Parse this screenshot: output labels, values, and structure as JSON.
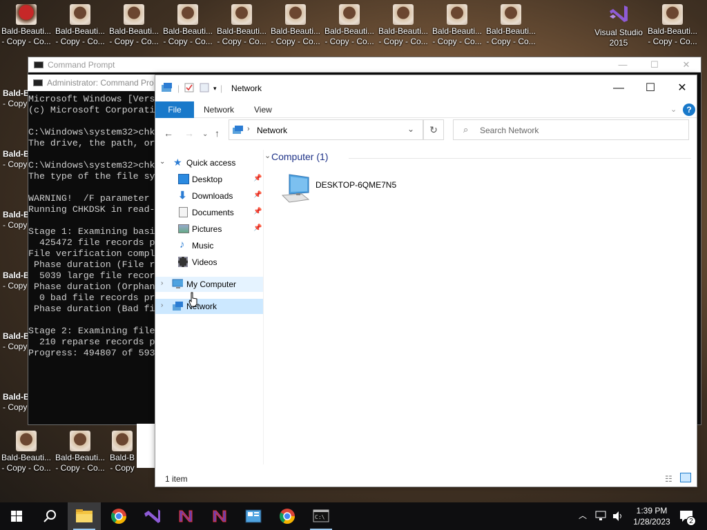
{
  "desktop": {
    "top_icons": [
      {
        "l1": "Bald-Beauti...",
        "l2": "- Copy - Co...",
        "type": "photo"
      },
      {
        "l1": "Bald-Beauti...",
        "l2": "- Copy - Co...",
        "type": "photo"
      },
      {
        "l1": "Bald-Beauti...",
        "l2": "- Copy - Co...",
        "type": "photo"
      },
      {
        "l1": "Bald-Beauti...",
        "l2": "- Copy - Co...",
        "type": "photo"
      },
      {
        "l1": "Bald-Beauti...",
        "l2": "- Copy - Co...",
        "type": "photo"
      },
      {
        "l1": "Bald-Beauti...",
        "l2": "- Copy - Co...",
        "type": "photo"
      },
      {
        "l1": "Bald-Beauti...",
        "l2": "- Copy - Co...",
        "type": "photo"
      },
      {
        "l1": "Bald-Beauti...",
        "l2": "- Copy - Co...",
        "type": "photo"
      },
      {
        "l1": "Bald-Beauti...",
        "l2": "- Copy - Co...",
        "type": "photo"
      },
      {
        "l1": "Visual Studio",
        "l2": "2015",
        "type": "vs"
      },
      {
        "l1": "Bald-Beauti...",
        "l2": "- Copy - Co...",
        "type": "photo"
      }
    ],
    "first_icon": {
      "l1": "Bald-Beauti...",
      "l2": "- Copy - Co..."
    },
    "left_icons": [
      {
        "l1": "Bald-B",
        "l2": "- Copy"
      },
      {
        "l1": "Bald-B",
        "l2": "- Copy"
      },
      {
        "l1": "Bald-B",
        "l2": "- Copy"
      },
      {
        "l1": "Bald-B",
        "l2": "- Copy"
      },
      {
        "l1": "Bald-B",
        "l2": "- Copy"
      },
      {
        "l1": "Bald-B",
        "l2": "- Copy"
      }
    ],
    "bottom_icons": [
      {
        "l1": "Bald-Beauti...",
        "l2": "- Copy - Co..."
      },
      {
        "l1": "Bald-Beauti...",
        "l2": "- Copy - Co..."
      },
      {
        "l1": "Bald-B",
        "l2": "- Copy"
      }
    ]
  },
  "cmd_window": {
    "title": "Command Prompt",
    "inner_title": "Administrator: Command Pro",
    "lines": [
      "Microsoft Windows [Vers",
      "(c) Microsoft Corporati",
      "",
      "C:\\Windows\\system32>chk",
      "The drive, the path, or",
      "",
      "C:\\Windows\\system32>chk",
      "The type of the file sy",
      "",
      "WARNING!  /F parameter ",
      "Running CHKDSK in read-",
      "",
      "Stage 1: Examining basi",
      "  425472 file records p",
      "File verification compl",
      " Phase duration (File r",
      "  5039 large file recor",
      " Phase duration (Orphan",
      "  0 bad file records pr",
      " Phase duration (Bad fi",
      "",
      "Stage 2: Examining file",
      "  210 reparse records p",
      "Progress: 494807 of 593"
    ]
  },
  "explorer": {
    "title": "Network",
    "tabs": {
      "file": "File",
      "network": "Network",
      "view": "View"
    },
    "address": "Network",
    "search_placeholder": "Search Network",
    "nav": {
      "quick_access": "Quick access",
      "desktop": "Desktop",
      "downloads": "Downloads",
      "documents": "Documents",
      "pictures": "Pictures",
      "music": "Music",
      "videos": "Videos",
      "my_computer": "My Computer",
      "network": "Network"
    },
    "group_header": "Computer (1)",
    "items": [
      {
        "name": "DESKTOP-6QME7N5",
        "icon": "computer-icon"
      }
    ],
    "status": "1 item"
  },
  "taskbar": {
    "time": "1:39 PM",
    "date": "1/28/2023",
    "notification_count": "2"
  }
}
